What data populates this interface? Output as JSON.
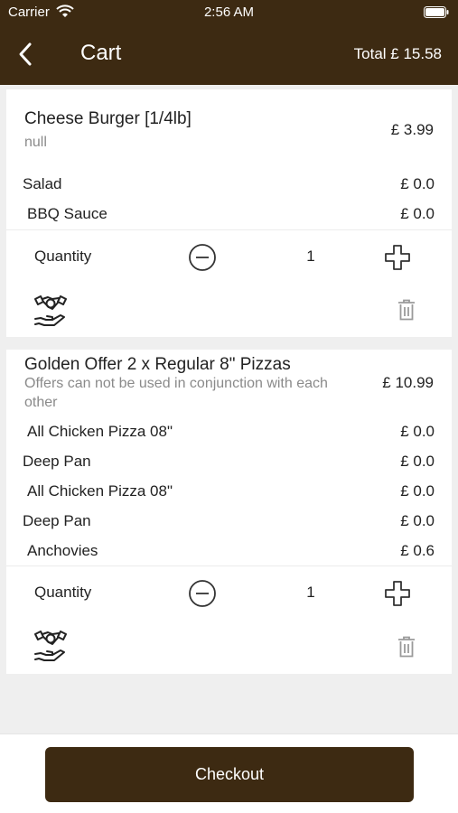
{
  "status_bar": {
    "carrier": "Carrier",
    "time": "2:56 AM"
  },
  "nav": {
    "title": "Cart",
    "total": "Total £ 15.58"
  },
  "colors": {
    "brand": "#3d2a12",
    "background": "#efefef"
  },
  "cart": {
    "items": [
      {
        "name": "Cheese Burger [1/4lb]",
        "description": "null",
        "price": "£ 3.99",
        "options": [
          {
            "name": "Salad",
            "price": "£ 0.0"
          },
          {
            "name": "BBQ Sauce",
            "price": "£ 0.0"
          }
        ],
        "quantity_label": "Quantity",
        "quantity": "1"
      },
      {
        "name": "Golden Offer 2 x Regular 8\" Pizzas",
        "description": "Offers can not be used in conjunction with each other",
        "price": "£ 10.99",
        "options": [
          {
            "name": "All Chicken Pizza 08\"",
            "price": "£ 0.0"
          },
          {
            "name": "Deep Pan",
            "price": "£ 0.0"
          },
          {
            "name": "All Chicken Pizza 08\"",
            "price": "£ 0.0"
          },
          {
            "name": "Deep Pan",
            "price": "£ 0.0"
          },
          {
            "name": "Anchovies",
            "price": "£ 0.6"
          }
        ],
        "quantity_label": "Quantity",
        "quantity": "1"
      }
    ]
  },
  "footer": {
    "checkout_label": "Checkout"
  }
}
